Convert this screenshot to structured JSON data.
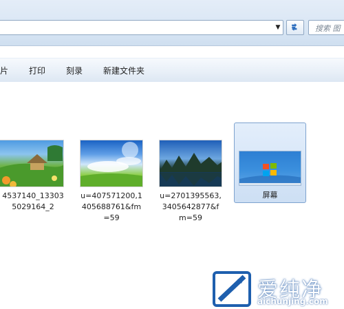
{
  "search": {
    "placeholder": "搜索 图"
  },
  "toolbar": {
    "items": [
      "片",
      "打印",
      "刻录",
      "新建文件夹"
    ]
  },
  "files": [
    {
      "name_line1": "4537140_13303",
      "name_line2": "5029164_2",
      "name_line3": ""
    },
    {
      "name_line1": "u=407571200,1",
      "name_line2": "405688761&fm",
      "name_line3": "=59"
    },
    {
      "name_line1": "u=2701395563,",
      "name_line2": "3405642877&f",
      "name_line3": "m=59"
    },
    {
      "name_line1": "屏幕",
      "name_line2": "",
      "name_line3": ""
    }
  ],
  "watermark": {
    "text": "爱纯净",
    "url": "aichunjing.com"
  },
  "colors": {
    "selection": "#cddff4",
    "toolbar": "#e9f0f8",
    "accent": "#2d7fd3"
  }
}
